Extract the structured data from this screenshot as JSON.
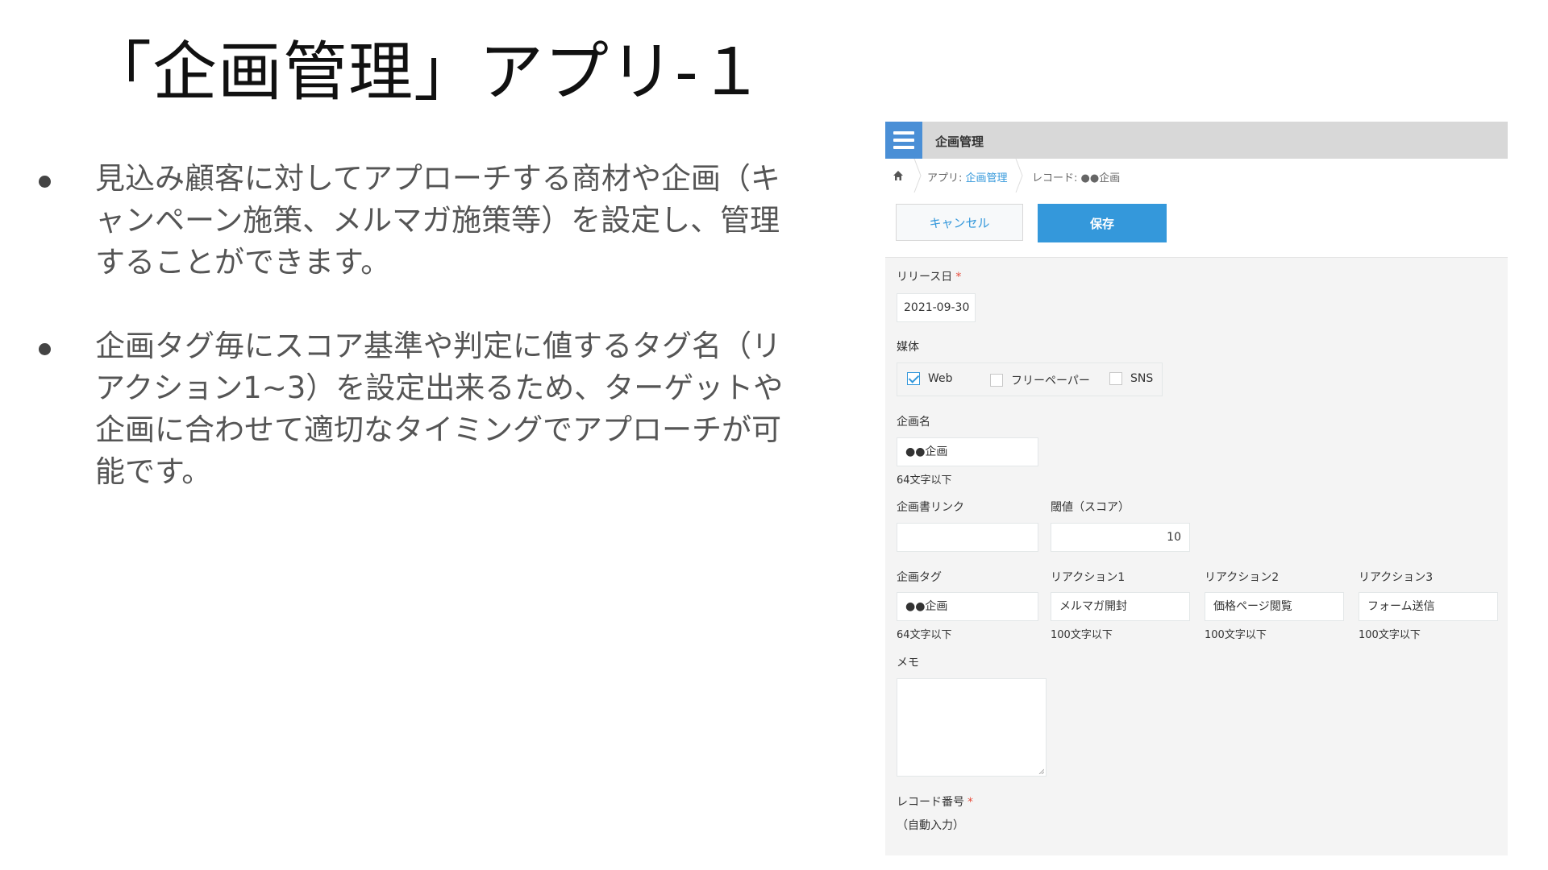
{
  "slide": {
    "title": "「企画管理」アプリ-１",
    "bullets": [
      "見込み顧客に対してアプローチする商材や企画（キャンペーン施策、メルマガ施策等）を設定し、管理することができます。",
      "企画タグ毎にスコア基準や判定に値するタグ名（リアクション1~3）を設定出来るため、ターゲットや企画に合わせて適切なタイミングでアプローチが可能です。"
    ]
  },
  "app": {
    "header_title": "企画管理",
    "icons": {
      "app": "list-icon",
      "home": "home-icon"
    },
    "breadcrumb": {
      "app_prefix": "アプリ: ",
      "app_name": "企画管理",
      "record": "レコード: ●●企画"
    },
    "toolbar": {
      "cancel_label": "キャンセル",
      "save_label": "保存"
    },
    "colors": {
      "accent": "#3498db",
      "required": "#e74c3c",
      "icon_bg": "#4a8fd6"
    },
    "form": {
      "release_date": {
        "label": "リリース日",
        "required_mark": "*",
        "value": "2021-09-30"
      },
      "media": {
        "label": "媒体",
        "options": [
          {
            "label": "Web",
            "checked": true
          },
          {
            "label": "フリーペーパー",
            "checked": false
          },
          {
            "label": "SNS",
            "checked": false
          }
        ]
      },
      "plan_name": {
        "label": "企画名",
        "value": "●●企画",
        "hint": "64文字以下"
      },
      "plan_link": {
        "label": "企画書リンク",
        "value": ""
      },
      "threshold": {
        "label": "閾値（スコア）",
        "value": "10"
      },
      "plan_tag": {
        "label": "企画タグ",
        "value": "●●企画",
        "hint": "64文字以下"
      },
      "reaction1": {
        "label": "リアクション1",
        "value": "メルマガ開封",
        "hint": "100文字以下"
      },
      "reaction2": {
        "label": "リアクション2",
        "value": "価格ページ閲覧",
        "hint": "100文字以下"
      },
      "reaction3": {
        "label": "リアクション3",
        "value": "フォーム送信",
        "hint": "100文字以下"
      },
      "memo": {
        "label": "メモ",
        "value": ""
      },
      "record_number": {
        "label": "レコード番号",
        "required_mark": "*",
        "value": "（自動入力）"
      }
    }
  }
}
